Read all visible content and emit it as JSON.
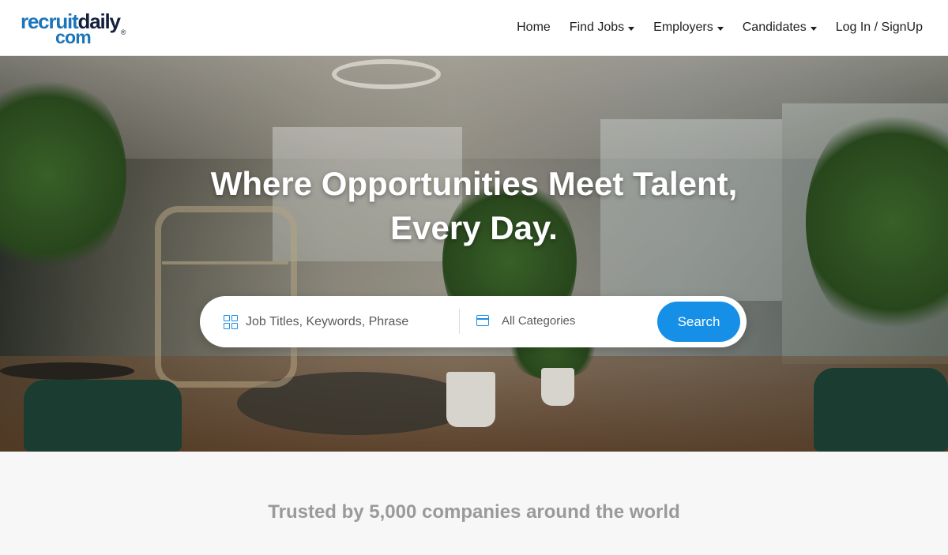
{
  "brand": {
    "logo_line1_a": "recruit",
    "logo_line1_b": "daily",
    "logo_line2": "com",
    "logo_registered": "®"
  },
  "nav": {
    "items": [
      {
        "label": "Home",
        "dropdown": false
      },
      {
        "label": "Find Jobs",
        "dropdown": true
      },
      {
        "label": "Employers",
        "dropdown": true
      },
      {
        "label": "Candidates",
        "dropdown": true
      },
      {
        "label": "Log In / SignUp",
        "dropdown": false
      }
    ]
  },
  "hero": {
    "headline_line1": "Where Opportunities Meet Talent,",
    "headline_line2": "Every Day."
  },
  "search": {
    "keywords_placeholder": "Job Titles, Keywords, Phrase",
    "category_placeholder": "All Categories",
    "button_label": "Search",
    "keywords_icon": "grid-icon",
    "category_icon": "calendar-icon"
  },
  "trusted": {
    "text": "Trusted by 5,000 companies around the world"
  },
  "colors": {
    "accent": "#1690e6",
    "logo_blue": "#1b75bb",
    "logo_navy": "#14213d"
  }
}
